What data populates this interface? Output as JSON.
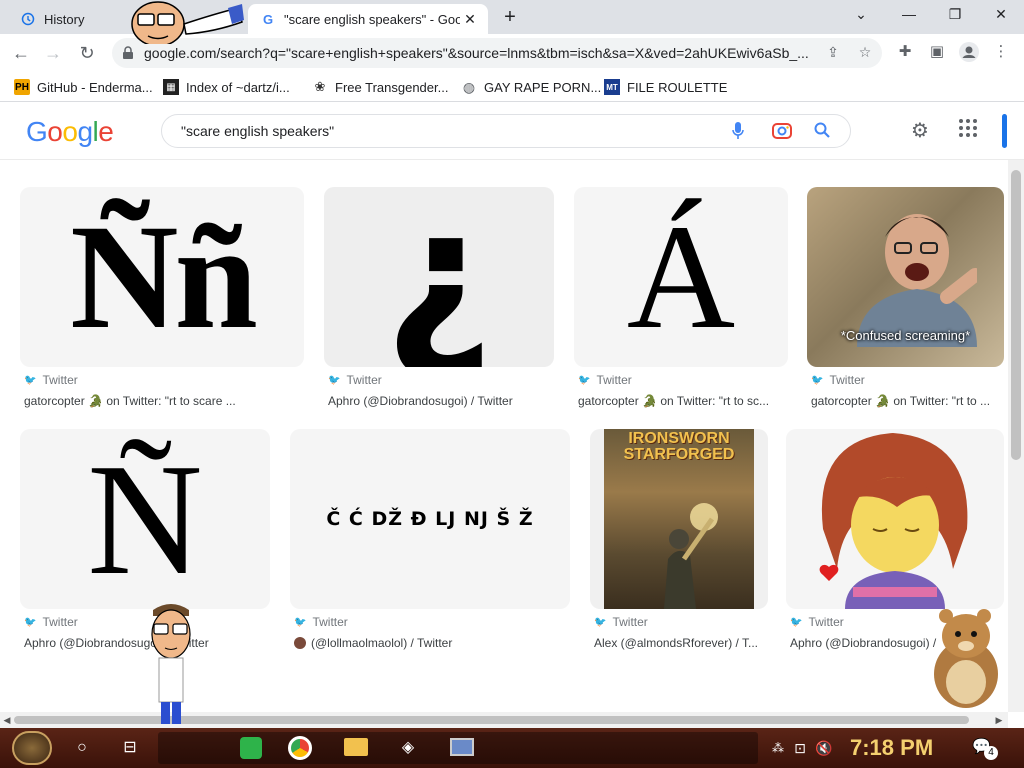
{
  "browser": {
    "tabs": [
      {
        "title": "History",
        "active": false
      },
      {
        "title": "\"scare english speakers\" - Goog",
        "active": true
      }
    ],
    "url": "google.com/search?q=\"scare+english+speakers\"&source=lnms&tbm=isch&sa=X&ved=2ahUKEwiv6aSb_...",
    "bookmarks": [
      {
        "label": "GitHub - Enderma...",
        "icon": "PH"
      },
      {
        "label": "Index of ~dartz/i...",
        "icon": "index-icon"
      },
      {
        "label": "Free Transgender...",
        "icon": "paw-icon"
      },
      {
        "label": "GAY RAPE PORN...",
        "icon": "globe-icon"
      },
      {
        "label": "FILE ROULETTE",
        "icon": "file-icon"
      }
    ]
  },
  "google": {
    "logo": "Google",
    "query": "\"scare english speakers\""
  },
  "results": [
    {
      "glyph": "Ññ",
      "source": "Twitter",
      "caption": "gatorcopter 🐊 on Twitter: \"rt to scare ..."
    },
    {
      "glyph": "¿",
      "source": "Twitter",
      "caption": "Aphro (@Diobrandosugoi) / Twitter"
    },
    {
      "glyph": "Á",
      "source": "Twitter",
      "caption": "gatorcopter 🐊 on Twitter: \"rt to sc..."
    },
    {
      "glyph": "*Confused screaming*",
      "source": "Twitter",
      "caption": "gatorcopter 🐊 on Twitter: \"rt to ..."
    },
    {
      "glyph": "Ñ",
      "source": "Twitter",
      "caption": "Aphro (@Diobrandosugoi) / Twitter"
    },
    {
      "glyph": "Č Ć DŽ Đ LJ NJ Š Ž",
      "source": "Twitter",
      "caption": "(@lollmaolmaolol) / Twitter"
    },
    {
      "glyph": "IRONSWORN STARFORGED",
      "source": "Twitter",
      "caption": "Alex (@almondsRforever) / T..."
    },
    {
      "glyph": "",
      "source": "Twitter",
      "caption": "Aphro (@Diobrandosugoi) /"
    }
  ],
  "taskbar": {
    "clock": "7:18 PM",
    "notifications": "4"
  },
  "colors": {
    "google_blue": "#4285f4",
    "google_red": "#ea4335",
    "google_yellow": "#fbbc05",
    "google_green": "#34a853",
    "twitter": "#1da1f2",
    "taskbar": "#4a1a0e",
    "clock": "#f4d06f"
  }
}
